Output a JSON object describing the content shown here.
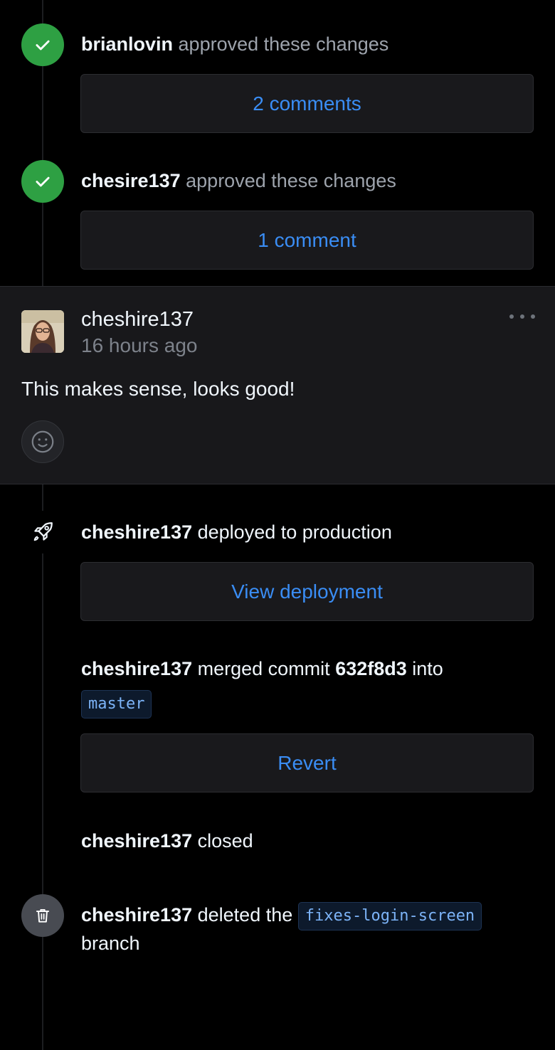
{
  "timeline": {
    "events": [
      {
        "type": "review-approved",
        "actor": "brianlovin",
        "action": "approved these changes",
        "button_label": "2 comments"
      },
      {
        "type": "review-approved",
        "actor": "chesire137",
        "action": "approved these changes",
        "button_label": "1 comment"
      }
    ],
    "comment": {
      "author": "cheshire137",
      "time": "16 hours ago",
      "body": "This makes sense, looks good!",
      "more_icon": "ellipsis-icon",
      "reaction_icon": "smiley-icon"
    },
    "deploy": {
      "icon": "rocket-icon",
      "actor": "cheshire137",
      "action": "deployed to production",
      "button_label": "View deployment"
    },
    "merge": {
      "actor": "cheshire137",
      "action": "merged commit",
      "commit": "632f8d3",
      "into": "into",
      "branch": "master",
      "button_label": "Revert"
    },
    "closed": {
      "actor": "cheshire137",
      "action": "closed"
    },
    "deleted": {
      "icon": "trash-icon",
      "actor": "cheshire137",
      "action": "deleted the",
      "branch": "fixes-login-screen",
      "suffix": "branch"
    }
  },
  "colors": {
    "background": "#000000",
    "card": "#19191c",
    "accent_blue": "#3a8df4",
    "approved_green": "#2ea043",
    "muted_text": "#9da3ac"
  }
}
